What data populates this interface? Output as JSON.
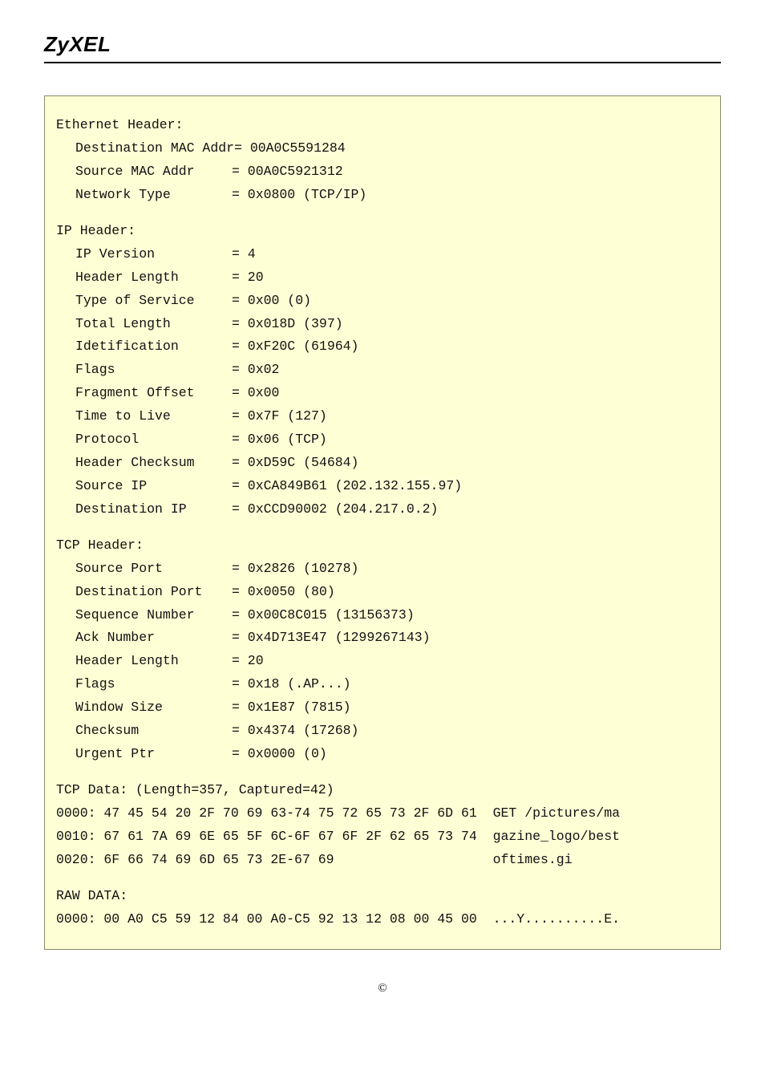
{
  "brand": "ZyXEL",
  "ethernet": {
    "title": "Ethernet Header:",
    "rows": [
      {
        "label": "Destination MAC Addr",
        "value": "= 00A0C5591284"
      },
      {
        "label": "Source MAC Addr",
        "value": "= 00A0C5921312"
      },
      {
        "label": "Network Type",
        "value": "= 0x0800 (TCP/IP)"
      }
    ]
  },
  "ip": {
    "title": "IP Header:",
    "rows": [
      {
        "label": "IP Version",
        "value": "= 4"
      },
      {
        "label": "Header Length",
        "value": "= 20"
      },
      {
        "label": "Type of Service",
        "value": "= 0x00 (0)"
      },
      {
        "label": "Total Length",
        "value": "= 0x018D (397)"
      },
      {
        "label": "Idetification",
        "value": "= 0xF20C (61964)"
      },
      {
        "label": "Flags",
        "value": "= 0x02"
      },
      {
        "label": "Fragment Offset",
        "value": "= 0x00"
      },
      {
        "label": "Time to Live",
        "value": "= 0x7F (127)"
      },
      {
        "label": "Protocol",
        "value": "= 0x06 (TCP)"
      },
      {
        "label": "Header Checksum",
        "value": "= 0xD59C (54684)"
      },
      {
        "label": "Source IP",
        "value": "= 0xCA849B61 (202.132.155.97)"
      },
      {
        "label": "Destination IP",
        "value": "= 0xCCD90002 (204.217.0.2)"
      }
    ]
  },
  "tcp": {
    "title": "TCP Header:",
    "rows": [
      {
        "label": "Source Port",
        "value": "= 0x2826 (10278)"
      },
      {
        "label": "Destination Port",
        "value": "= 0x0050 (80)"
      },
      {
        "label": "Sequence Number",
        "value": "= 0x00C8C015 (13156373)"
      },
      {
        "label": "Ack Number",
        "value": "= 0x4D713E47 (1299267143)"
      },
      {
        "label": "Header Length",
        "value": "= 20"
      },
      {
        "label": "Flags",
        "value": "= 0x18 (.AP...)"
      },
      {
        "label": "Window Size",
        "value": "= 0x1E87 (7815)"
      },
      {
        "label": "Checksum",
        "value": "= 0x4374 (17268)"
      },
      {
        "label": "Urgent Ptr",
        "value": "= 0x0000 (0)"
      }
    ]
  },
  "tcpdata": {
    "title": "TCP Data: (Length=357, Captured=42)",
    "lines": [
      "0000: 47 45 54 20 2F 70 69 63-74 75 72 65 73 2F 6D 61  GET /pictures/ma",
      "0010: 67 61 7A 69 6E 65 5F 6C-6F 67 6F 2F 62 65 73 74  gazine_logo/best",
      "0020: 6F 66 74 69 6D 65 73 2E-67 69                    oftimes.gi"
    ]
  },
  "raw": {
    "title": "RAW DATA:",
    "lines": [
      "0000: 00 A0 C5 59 12 84 00 A0-C5 92 13 12 08 00 45 00  ...Y..........E."
    ]
  },
  "footer": "©"
}
